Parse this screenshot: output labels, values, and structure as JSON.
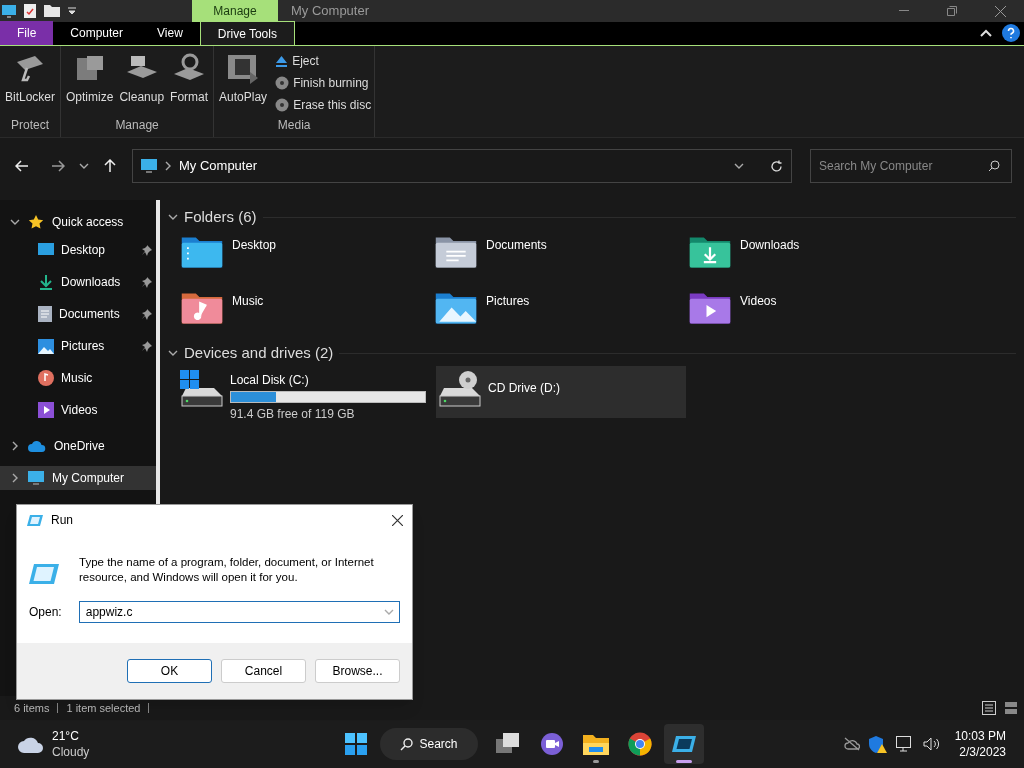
{
  "title_bar": {
    "context_tab": "Manage",
    "title": "My Computer"
  },
  "ribbon_tabs": [
    {
      "label": "File",
      "kind": "file",
      "selected": false
    },
    {
      "label": "Computer",
      "kind": "tab",
      "selected": false
    },
    {
      "label": "View",
      "kind": "tab",
      "selected": false
    },
    {
      "label": "Drive Tools",
      "kind": "tab",
      "selected": true
    }
  ],
  "ribbon_groups": [
    {
      "label": "Protect",
      "buttons": [
        {
          "label": "BitLocker",
          "kind": "bitlocker"
        }
      ]
    },
    {
      "label": "Manage",
      "buttons": [
        {
          "label": "Optimize",
          "kind": "optimize"
        },
        {
          "label": "Cleanup",
          "kind": "cleanup"
        },
        {
          "label": "Format",
          "kind": "format"
        }
      ]
    },
    {
      "label": "Media",
      "buttons": [
        {
          "label": "AutoPlay",
          "kind": "autoplay"
        },
        {
          "label": "Eject",
          "kind": "eject"
        },
        {
          "label": "Finish burning",
          "kind": "disc"
        },
        {
          "label": "Erase this disc",
          "kind": "disc"
        }
      ]
    }
  ],
  "address_bar": {
    "path": "My Computer"
  },
  "search": {
    "placeholder": "Search My Computer"
  },
  "sidebar": {
    "items": [
      {
        "label": "Quick access",
        "kind": "star",
        "expanded": true,
        "selected": false,
        "children": [
          {
            "label": "Desktop",
            "kind": "desktop",
            "pinned": true
          },
          {
            "label": "Downloads",
            "kind": "downloads",
            "pinned": true
          },
          {
            "label": "Documents",
            "kind": "documents",
            "pinned": true
          },
          {
            "label": "Pictures",
            "kind": "pictures",
            "pinned": true
          },
          {
            "label": "Music",
            "kind": "music",
            "pinned": false
          },
          {
            "label": "Videos",
            "kind": "videos",
            "pinned": false
          }
        ]
      },
      {
        "label": "OneDrive",
        "kind": "cloud",
        "expanded": false,
        "selected": false
      },
      {
        "label": "My Computer",
        "kind": "computer",
        "expanded": false,
        "selected": true
      }
    ]
  },
  "folders": {
    "heading": "Folders (6)",
    "items": [
      {
        "label": "Desktop",
        "kind": "desktop"
      },
      {
        "label": "Documents",
        "kind": "documents"
      },
      {
        "label": "Downloads",
        "kind": "downloads"
      },
      {
        "label": "Music",
        "kind": "music"
      },
      {
        "label": "Pictures",
        "kind": "pictures"
      },
      {
        "label": "Videos",
        "kind": "videos"
      }
    ]
  },
  "drives": {
    "heading": "Devices and drives (2)",
    "items": [
      {
        "label": "Local Disk (C:)",
        "kind": "disk",
        "level": 0.23,
        "caption": "91.4 GB free of 119 GB",
        "selected": false
      },
      {
        "label": "CD Drive (D:)",
        "kind": "cd",
        "selected": true
      }
    ]
  },
  "status_bar": [
    "6 items",
    "1 item selected"
  ],
  "run_dialog": {
    "title": "Run",
    "message": "Type the name of a program, folder, document, or Internet resource, and Windows will open it for you.",
    "open_label": "Open:",
    "value": "appwiz.c",
    "buttons": [
      {
        "label": "OK",
        "default": true
      },
      {
        "label": "Cancel",
        "default": false
      },
      {
        "label": "Browse...",
        "default": false
      }
    ]
  },
  "taskbar": {
    "temperature": "21°C",
    "condition": "Cloudy",
    "search": "Search",
    "apps": [
      {
        "kind": "taskview",
        "running": false,
        "active": false
      },
      {
        "kind": "chat",
        "running": false,
        "active": false
      },
      {
        "kind": "explorer",
        "running": true,
        "active": false
      },
      {
        "kind": "chrome",
        "running": false,
        "active": false
      },
      {
        "kind": "run",
        "running": true,
        "active": true
      }
    ],
    "time": "10:03 PM",
    "date": "2/3/2023"
  }
}
